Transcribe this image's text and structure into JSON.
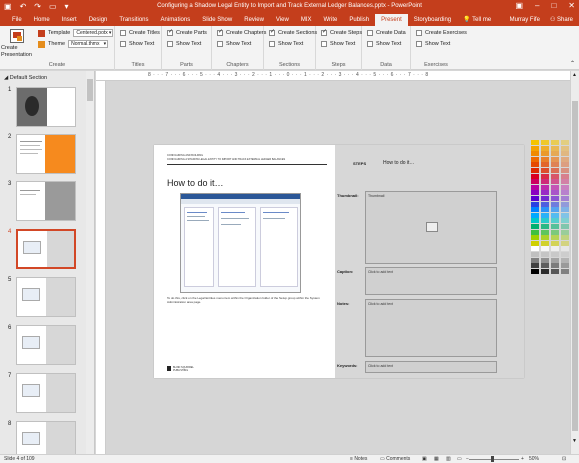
{
  "window": {
    "title": "Configuring a Shadow Legal Entity to Import and Track External Ledger Balances.pptx - PowerPoint",
    "qat": [
      "save-icon",
      "undo-icon",
      "redo-icon",
      "start-icon",
      "customize-icon"
    ],
    "winbtns": [
      "ribbon-options-icon",
      "minimize-icon",
      "maximize-icon",
      "close-icon"
    ]
  },
  "tabs": [
    "File",
    "Home",
    "Insert",
    "Design",
    "Transitions",
    "Animations",
    "Slide Show",
    "Review",
    "View",
    "MIX",
    "Write",
    "Publish",
    "Present",
    "Storyboarding"
  ],
  "tell_me": "Tell me",
  "user": "Murray Fife",
  "share": "Share",
  "ribbon": {
    "create": {
      "button": "Create",
      "button2": "Presentation",
      "template_label": "Template",
      "template_value": "Centered.potx",
      "theme_label": "Theme",
      "theme_value": "Normal.thmx",
      "group": "Create"
    },
    "titles": {
      "create": "Create Titles",
      "show": "Show Text",
      "group": "Titles"
    },
    "parts": {
      "create": "Create Parts",
      "show": "Show Text",
      "group": "Parts"
    },
    "chapters": {
      "create": "Create Chapters",
      "show": "Show Text",
      "group": "Chapters"
    },
    "sections": {
      "create": "Create Sections",
      "show": "Show Text",
      "group": "Sections"
    },
    "steps": {
      "create": "Create Steps",
      "show": "Show Text",
      "group": "Steps"
    },
    "data": {
      "create": "Create Data",
      "show": "Show Text",
      "group": "Data"
    },
    "exercises": {
      "create": "Create Exercises",
      "show": "Show Text",
      "group": "Exercises"
    }
  },
  "panel": {
    "section": "Default Section",
    "slides": [
      {
        "num": "1",
        "kind": "cover"
      },
      {
        "num": "2",
        "kind": "orange"
      },
      {
        "num": "3",
        "kind": "gray"
      },
      {
        "num": "4",
        "kind": "howto",
        "active": true
      },
      {
        "num": "5",
        "kind": "howto"
      },
      {
        "num": "6",
        "kind": "howto"
      },
      {
        "num": "7",
        "kind": "howto"
      },
      {
        "num": "8",
        "kind": "howto"
      }
    ]
  },
  "ruler": "8 · · · 7 · · · 6 · · · 5 · · · 4 · · · 3 · · · 2 · · · 1 · · · 0 · · · 1 · · · 2 · · · 3 · · · 4 · · · 5 · · · 6 · · · 7 · · · 8",
  "slide": {
    "header_line1": "CONFIGURING AND BUILDING",
    "header_line2": "CONFIGURING A SHADOW LEGAL ENTITY TO IMPORT AND TRACK EXTERNAL LEDGER BALANCES",
    "title": "How to do it…",
    "caption": "To do this, click on the Legal Entities menu item within the Organization folder of the Setup group within the System Administration area page.",
    "logo": "BLIND SQUIRREL PUBLISHING",
    "steps_label": "STEPS",
    "steps_value": "How to do it…",
    "thumbnail_label": "Thumbnail:",
    "thumbnail_value": "Thumbnail",
    "caption_label": "Caption:",
    "caption_value": "Click to add text",
    "notes_label": "Notes:",
    "notes_value": "Click to add text",
    "keywords_label": "Keywords:",
    "keywords_value": "Click to add text"
  },
  "palette_colors": [
    "#f5c400",
    "#f5a300",
    "#f08a00",
    "#ee6a00",
    "#e54a00",
    "#dd2a00",
    "#d90020",
    "#cc0060",
    "#b800a0",
    "#8a00c0",
    "#5a00d0",
    "#2a40e0",
    "#0080ff",
    "#00a8ff",
    "#00c8c8",
    "#00b070",
    "#40c040",
    "#a0d000",
    "#d0d000",
    "#ffffff",
    "#c0c0c0",
    "#808080",
    "#404040",
    "#000000"
  ],
  "status": {
    "slide": "Slide 4 of 109",
    "notes": "Notes",
    "comments": "Comments",
    "zoom": "50%"
  }
}
